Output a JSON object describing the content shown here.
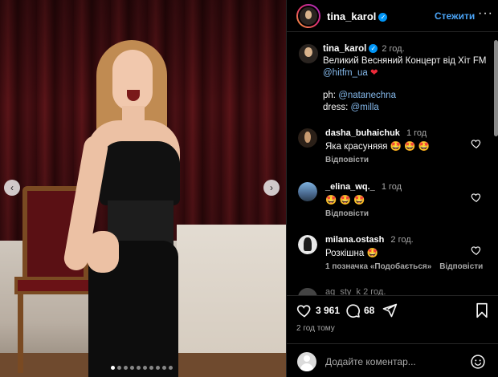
{
  "post": {
    "author": "tina_karol",
    "follow_label": "Стежити",
    "more_label": "···",
    "caption": {
      "time": "2 год.",
      "line1": "Великий Весняний Концерт від Хіт FM",
      "mention_hitfm": "@hitfm_ua",
      "heart": "❤",
      "ph_label": "ph: ",
      "ph_mention": "@natanechna",
      "dress_label": "dress: ",
      "dress_mention": "@milla"
    },
    "likes": "3 961",
    "comments_count": "68",
    "posted_ago": "2 год тому"
  },
  "comments": [
    {
      "user": "dasha_buhaichuk",
      "time": "1 год",
      "text": "Яка красуняяя 🤩 🤩 🤩",
      "meta": [
        "Відповісти"
      ]
    },
    {
      "user": "_elina_wq._",
      "time": "1 год",
      "text": "🤩 🤩 🤩",
      "meta": [
        "Відповісти"
      ]
    },
    {
      "user": "milana.ostash",
      "time": "2 год.",
      "text": "Розкішна 🤩",
      "meta": [
        "1 позначка «Подобається»",
        "Відповісти"
      ]
    }
  ],
  "partial_comment": "ag_sty_k 2 год.",
  "composer": {
    "placeholder": "Додайте коментар..."
  },
  "carousel": {
    "total": 10,
    "active": 0,
    "prev_glyph": "‹",
    "next_glyph": "›"
  },
  "colors": {
    "accent": "#0095f6",
    "link": "#84b8ea",
    "follow": "#4aa3f5",
    "heart": "#ed2a39"
  },
  "icons": [
    "verified-icon",
    "more-icon",
    "heart-icon",
    "comment-icon",
    "share-icon",
    "bookmark-icon",
    "emoji-icon",
    "chevron-left-icon",
    "chevron-right-icon"
  ]
}
